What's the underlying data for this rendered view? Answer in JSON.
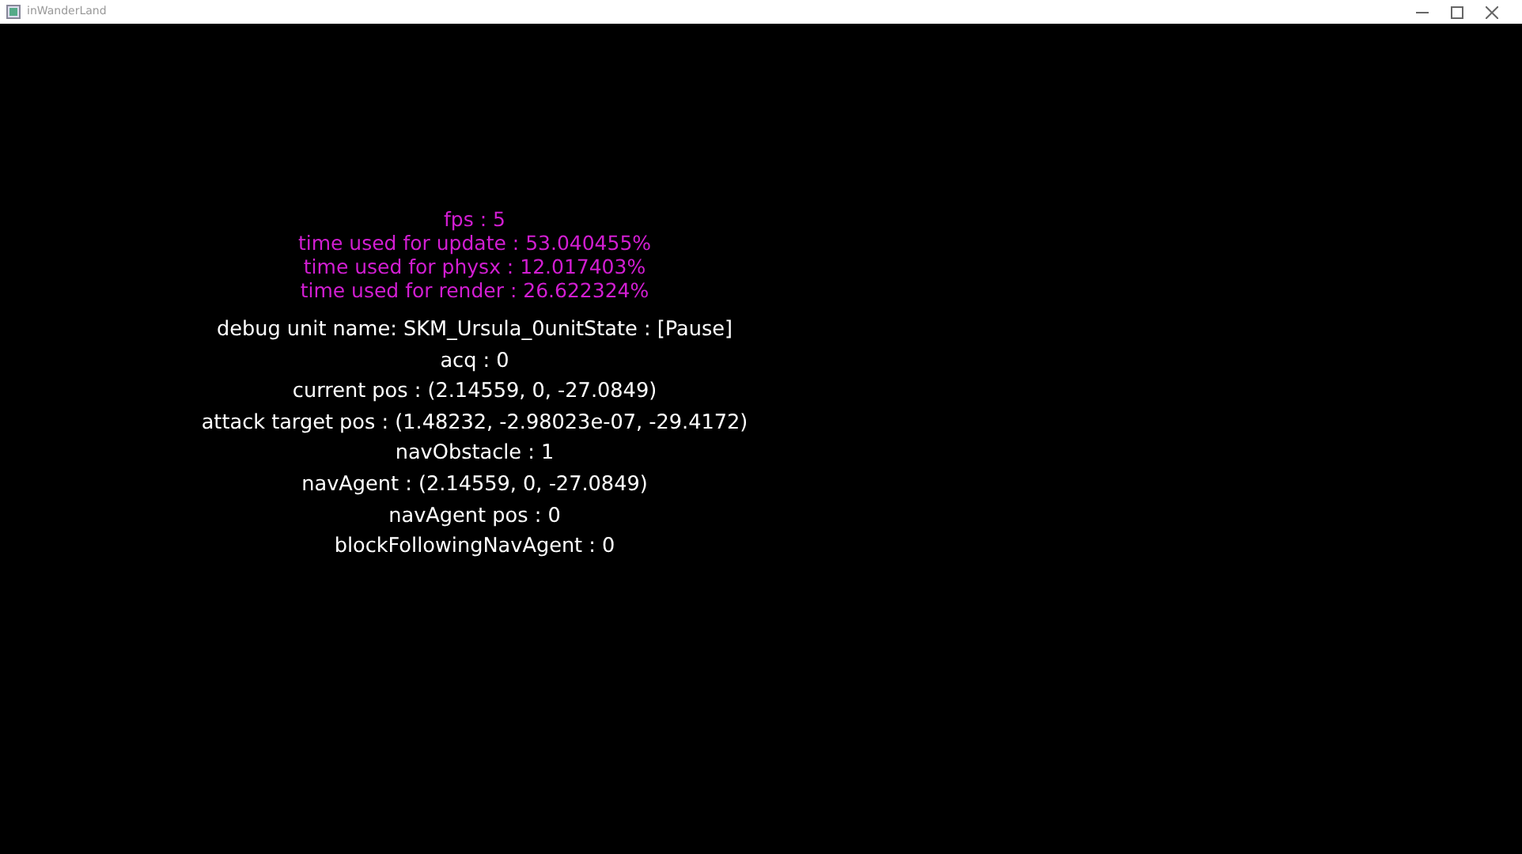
{
  "window": {
    "title": "inWanderLand"
  },
  "performance": [
    "fps : 5",
    "time used for update : 53.040455%",
    "time used for physx : 12.017403%",
    "time used for render : 26.622324%"
  ],
  "debug": [
    "debug unit name: SKM_Ursula_0unitState : [Pause]",
    "acq : 0",
    "current pos : (2.14559, 0, -27.0849)",
    "attack target pos : (1.48232, -2.98023e-07, -29.4172)",
    "navObstacle : 1",
    "navAgent : (2.14559, 0, -27.0849)",
    "navAgent pos : 0",
    "blockFollowingNavAgent : 0"
  ]
}
